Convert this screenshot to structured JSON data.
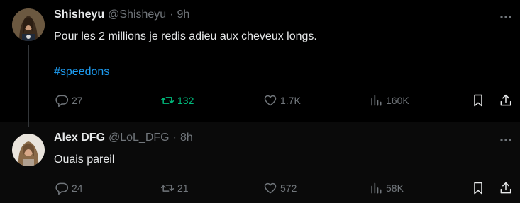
{
  "tweets": [
    {
      "display_name": "Shisheyu",
      "handle": "@Shisheyu",
      "separator": "·",
      "time": "9h",
      "text": "Pour les 2 millions je redis adieu aux cheveux longs.",
      "hashtag": "#speedons",
      "replies": "27",
      "retweets": "132",
      "retweeted": true,
      "likes": "1.7K",
      "views": "160K"
    },
    {
      "display_name": "Alex DFG",
      "handle": "@LoL_DFG",
      "separator": "·",
      "time": "8h",
      "text": "Ouais pareil",
      "replies": "24",
      "retweets": "21",
      "retweeted": false,
      "likes": "572",
      "views": "58K"
    }
  ],
  "icons": [
    "more-icon",
    "reply-icon",
    "retweet-icon",
    "like-icon",
    "views-icon",
    "bookmark-icon",
    "share-icon"
  ],
  "colors": {
    "background": "#000000",
    "text": "#e7e9ea",
    "muted": "#71767b",
    "hashtag": "#1d9bf0",
    "retweet_active": "#00ba7c"
  }
}
